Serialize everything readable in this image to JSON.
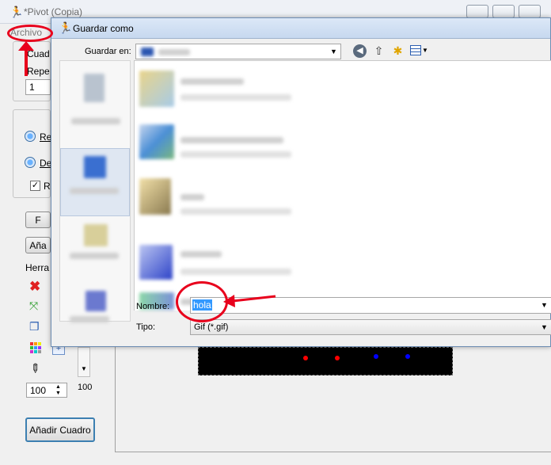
{
  "app": {
    "title": "*Pivot (Copia)",
    "menu_archivo": "Archivo",
    "panel_label_1": "Cuad",
    "panel_label_2": "Repe",
    "repeat_value": "1",
    "radio1_label": "Re",
    "radio2_label": "De",
    "check_label": "R",
    "check_mark": "✓",
    "button_1": "F",
    "button_2": "Aña",
    "tools_label": "Herra",
    "zoom_value": "100",
    "zoom_label": "100",
    "add_frame_button": "Añadir Cuadro"
  },
  "dialog": {
    "title": "Guardar como",
    "save_in_label": "Guardar en:",
    "name_label": "Nombre:",
    "name_value": "hola",
    "type_label": "Tipo:",
    "type_value": "Gif (*.gif)"
  },
  "colors": {
    "accent_red": "#e8001c",
    "canvas_black": "#000000",
    "dot_red": "#ff0000",
    "dot_blue": "#0000ff"
  }
}
